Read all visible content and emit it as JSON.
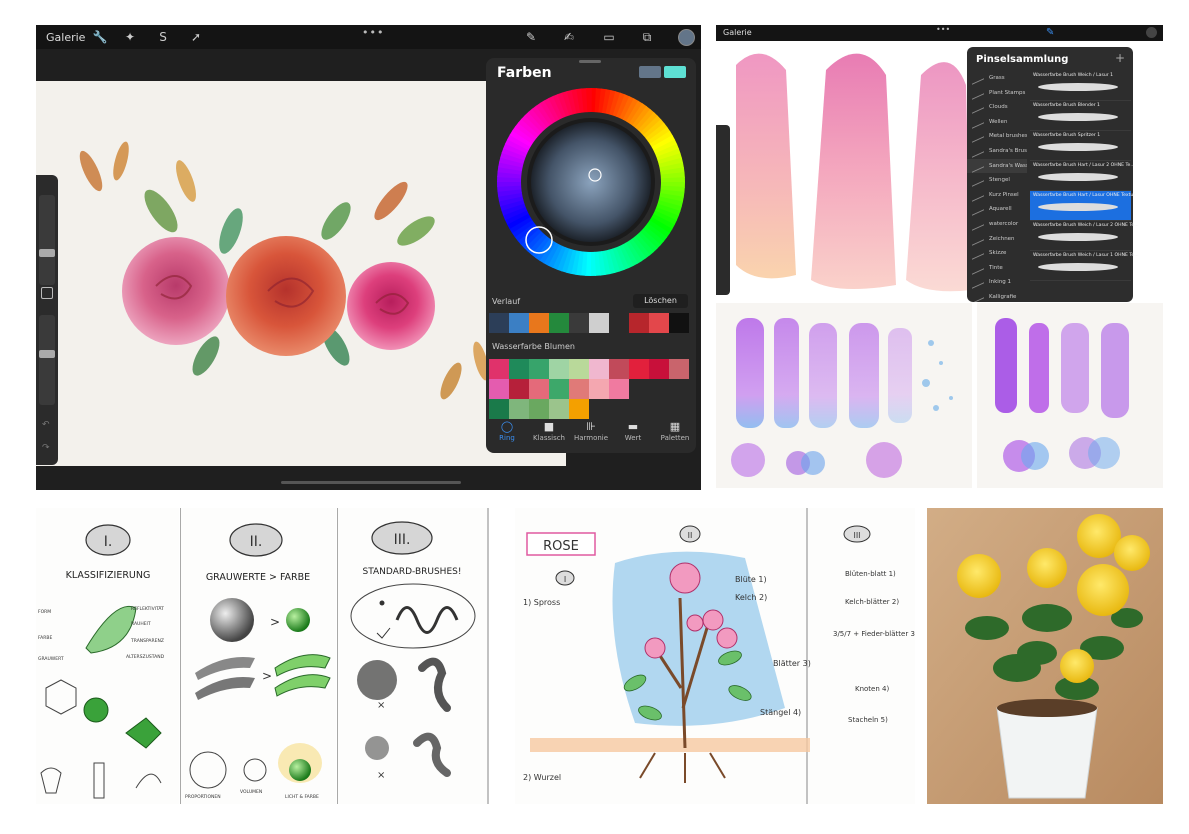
{
  "main_app": {
    "gallery_label": "Galerie",
    "colors_panel": {
      "title": "Farben",
      "history_label": "Verlauf",
      "clear_label": "Löschen",
      "palette_name": "Wasserfarbe Blumen",
      "primary_color": "#637589",
      "secondary_color": "#5ee0d4",
      "history_colors": [
        "#2c3e58",
        "#3b7fc4",
        "#e8771c",
        "#24893c",
        "#3a3a3a",
        "#cfcfcf",
        "#2a2a2a",
        "#b7262c",
        "#e3474b",
        "#111111"
      ],
      "palette_rows": [
        [
          "#e0326b",
          "#1f8a5a",
          "#37a46b",
          "#9fd4a4",
          "#b9d99a",
          "#f0b7cf",
          "#c14a5a",
          "#e2203c",
          "#c8103a",
          "#c9646c"
        ],
        [
          "#e45caf",
          "#b6203a",
          "#e46a7a",
          "#3da86a",
          "#e07a78",
          "#f4a7b0",
          "#f07aa0",
          "#2a2a2a",
          "#2a2a2a",
          "#2a2a2a"
        ],
        [
          "#1a7a4a",
          "#7fb67c",
          "#6aa860",
          "#9bc48c",
          "#f4a000",
          "#2a2a2a",
          "#2a2a2a",
          "#2a2a2a",
          "#2a2a2a",
          "#2a2a2a"
        ]
      ],
      "tabs": [
        "Ring",
        "Klassisch",
        "Harmonie",
        "Wert",
        "Paletten"
      ]
    }
  },
  "brush_app": {
    "gallery_label": "Galerie",
    "panel_title": "Pinselsammlung",
    "categories": [
      "Grass",
      "Plant Stamps",
      "Clouds",
      "Wellen",
      "Metal brushes",
      "Sandra's Brushes",
      "Sandra's Wasserfa...",
      "Stengel",
      "Kurz Pinsel",
      "Aquarell",
      "watercolor",
      "Zeichnen",
      "Skizze",
      "Tinte",
      "Inking 1",
      "Kalligrafie"
    ],
    "brushes": [
      "Wasserfarbe Brush Weich / Lasur 1",
      "Wasserfarbe Brush Blender 1",
      "Wasserfarbe Brush Spritzer 1",
      "Wasserfarbe Brush Hart / Lasur 2 OHNE Te...",
      "Wasserfarbe Brush Hart / Lasur OHNE Textur",
      "Wasserfarbe Brush Weich / Lasur 2 OHNE Te...",
      "Wasserfarbe Brush Weich / Lasur 1 OHNE Te..."
    ]
  },
  "sketches": {
    "s1": {
      "roman": "I.",
      "title": "KLASSIFIZIERUNG",
      "labels": [
        "FORM",
        "FARBE",
        "GRAUWERT",
        "REFLEKTIVITÄT",
        "RAUHEIT",
        "TRANSPARENZ",
        "ALTERSZUSTAND"
      ]
    },
    "s2": {
      "roman": "II.",
      "title": "GRAUWERTE > FARBE",
      "labels": [
        "PROPORTIONEN",
        "VOLUMEN",
        "LICHT & FARBE"
      ]
    },
    "s3": {
      "roman": "III.",
      "title": "STANDARD-BRUSHES!"
    },
    "s4": {
      "title": "ROSE",
      "roman_left": "I",
      "roman_mid": "II",
      "roman_right": "III",
      "labels": [
        "1) Spross",
        "2) Wurzel",
        "Blüte 1)",
        "Kelch 2)",
        "Blätter 3)",
        "Stängel 4)",
        "Blüten-blatt 1)",
        "Kelch-blätter 2)",
        "3/5/7 + Fieder-blätter 3)",
        "Knoten 4)",
        "Stacheln 5)"
      ]
    }
  }
}
